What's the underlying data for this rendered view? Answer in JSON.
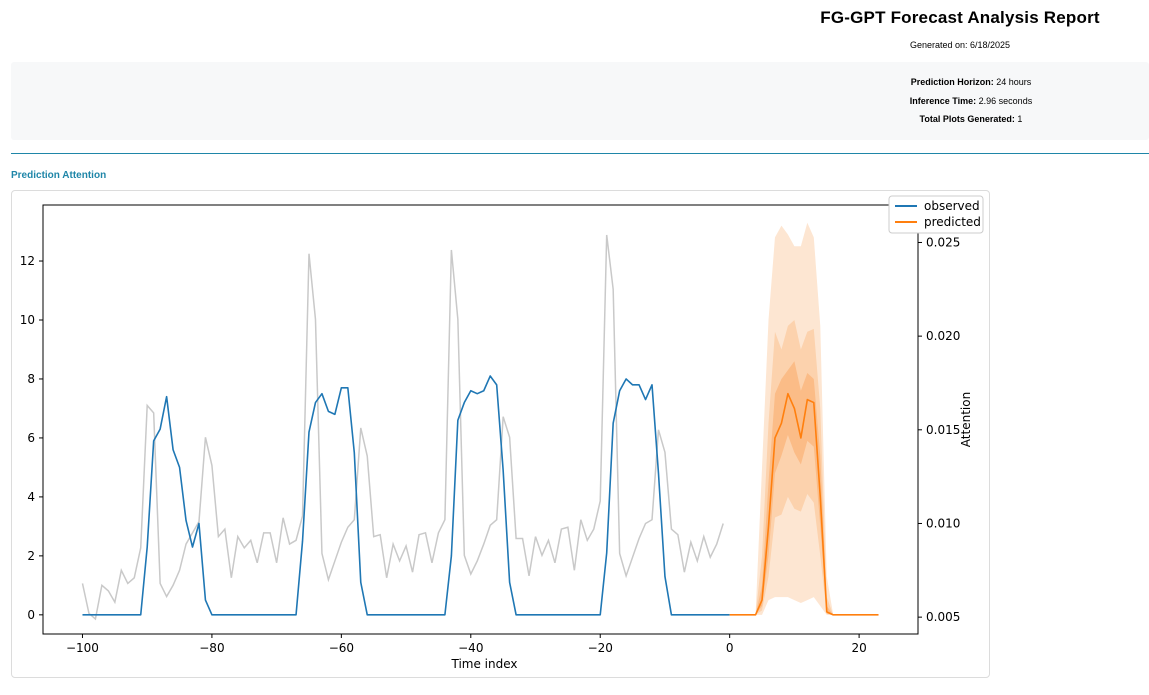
{
  "report": {
    "title": "FG-GPT Forecast Analysis Report",
    "generated_label": "Generated on:",
    "generated_date": "6/18/2025"
  },
  "summary": {
    "horizon_label": "Prediction Horizon:",
    "horizon_value": "24 hours",
    "inference_label": "Inference Time:",
    "inference_value": "2.96 seconds",
    "plots_label": "Total Plots Generated:",
    "plots_value": "1"
  },
  "section": {
    "title": "Prediction Attention"
  },
  "chart_data": {
    "type": "line",
    "xlabel": "Time index",
    "ylabel": "",
    "y2label": "Attention",
    "xlim": [
      -106.1,
      29.1
    ],
    "ylim": [
      -0.65,
      13.9
    ],
    "y2lim": [
      0.0041,
      0.027
    ],
    "xticks": [
      -100,
      -80,
      -60,
      -40,
      -20,
      0,
      20
    ],
    "xtick_labels": [
      "−100",
      "−80",
      "−60",
      "−40",
      "−20",
      "0",
      "20"
    ],
    "yticks": [
      0,
      2,
      4,
      6,
      8,
      10,
      12
    ],
    "y2ticks": [
      0.005,
      0.01,
      0.015,
      0.02,
      0.025
    ],
    "y2tick_labels": [
      "0.005",
      "0.010",
      "0.015",
      "0.020",
      "0.025"
    ],
    "legend_position": "top-right",
    "legend": [
      {
        "name": "observed",
        "color": "#1f77b4"
      },
      {
        "name": "predicted",
        "color": "#ff7f0e"
      }
    ],
    "colors": {
      "observed": "#1f77b4",
      "predicted": "#ff7f0e",
      "attention": "#c9c9c9",
      "band_outer": "#fde6d2",
      "band_middle": "#fcd2ad",
      "band_inner": "#fbbc87"
    },
    "observed": {
      "x_start": -100,
      "values": [
        0,
        0,
        0,
        0,
        0,
        0,
        0,
        0,
        0,
        0,
        2.3,
        5.9,
        6.3,
        7.4,
        5.6,
        5.0,
        3.2,
        2.3,
        3.1,
        0.5,
        0,
        0,
        0,
        0,
        0,
        0,
        0,
        0,
        0,
        0,
        0,
        0,
        0,
        0,
        2.5,
        6.2,
        7.2,
        7.5,
        6.9,
        6.8,
        7.7,
        7.7,
        5.5,
        1.1,
        0,
        0,
        0,
        0,
        0,
        0,
        0,
        0,
        0,
        0,
        0,
        0,
        0,
        2.0,
        6.6,
        7.2,
        7.6,
        7.5,
        7.6,
        8.1,
        7.8,
        4.9,
        1.1,
        0,
        0,
        0,
        0,
        0,
        0,
        0,
        0,
        0,
        0,
        0,
        0,
        0,
        0,
        2.1,
        6.5,
        7.6,
        8.0,
        7.8,
        7.8,
        7.3,
        7.8,
        4.8,
        1.3,
        0,
        0,
        0,
        0,
        0,
        0,
        0,
        0,
        0,
        0
      ]
    },
    "predicted": {
      "x_start": 0,
      "median": [
        0,
        0,
        0,
        0,
        0,
        0.5,
        3.0,
        6.0,
        6.5,
        7.5,
        7.0,
        6.0,
        7.3,
        7.2,
        4.0,
        0.1,
        0,
        0,
        0,
        0,
        0,
        0,
        0,
        0
      ],
      "band_inner_low": [
        0,
        0,
        0,
        0,
        0,
        0.3,
        2.0,
        4.8,
        5.4,
        6.1,
        5.5,
        5.1,
        5.9,
        5.7,
        3.0,
        0.05,
        0,
        0,
        0,
        0,
        0,
        0,
        0,
        0
      ],
      "band_inner_high": [
        0,
        0,
        0,
        0,
        0,
        1.0,
        4.5,
        7.5,
        8.0,
        8.3,
        8.6,
        7.6,
        8.2,
        8.0,
        5.4,
        0.3,
        0,
        0,
        0,
        0,
        0,
        0,
        0,
        0
      ],
      "band_middle_low": [
        0,
        0,
        0,
        0,
        0,
        0.15,
        1.3,
        3.3,
        3.4,
        4.0,
        3.6,
        3.5,
        4.1,
        3.8,
        2.0,
        0.03,
        0,
        0,
        0,
        0,
        0,
        0,
        0,
        0
      ],
      "band_middle_high": [
        0,
        0,
        0,
        0,
        0,
        2.0,
        6.5,
        9.6,
        9.0,
        9.8,
        10.0,
        9.0,
        9.6,
        9.7,
        7.0,
        0.6,
        0,
        0,
        0,
        0,
        0,
        0,
        0,
        0
      ],
      "band_outer_low": [
        0,
        0,
        0,
        0,
        0,
        0,
        0.5,
        0.6,
        0.6,
        0.6,
        0.5,
        0.4,
        0.5,
        0.6,
        0.3,
        0,
        0,
        0,
        0,
        0,
        0,
        0,
        0,
        0
      ],
      "band_outer_high": [
        0,
        0,
        0,
        0,
        0,
        5.0,
        10.0,
        12.8,
        13.2,
        12.9,
        12.5,
        12.5,
        13.3,
        12.8,
        9.8,
        1.3,
        0,
        0,
        0,
        0,
        0,
        0,
        0,
        0
      ]
    },
    "attention": {
      "x_start": -100,
      "values": [
        0.0068,
        0.0052,
        0.0049,
        0.0067,
        0.0064,
        0.0058,
        0.0075,
        0.0068,
        0.0071,
        0.0087,
        0.0163,
        0.0159,
        0.0068,
        0.0061,
        0.0067,
        0.0075,
        0.0089,
        0.0095,
        0.0101,
        0.0146,
        0.0131,
        0.0093,
        0.0097,
        0.0071,
        0.0093,
        0.0087,
        0.0091,
        0.0079,
        0.0095,
        0.0095,
        0.0079,
        0.0103,
        0.0089,
        0.0091,
        0.0104,
        0.0244,
        0.0209,
        0.0084,
        0.007,
        0.008,
        0.009,
        0.0098,
        0.0102,
        0.0151,
        0.0136,
        0.0093,
        0.0094,
        0.0071,
        0.0089,
        0.008,
        0.0088,
        0.0074,
        0.0094,
        0.0095,
        0.0079,
        0.0095,
        0.0102,
        0.0246,
        0.0209,
        0.0083,
        0.0073,
        0.008,
        0.0089,
        0.0099,
        0.0102,
        0.0157,
        0.0146,
        0.0092,
        0.0092,
        0.0072,
        0.0093,
        0.0083,
        0.0091,
        0.0079,
        0.0097,
        0.0098,
        0.0075,
        0.0102,
        0.0091,
        0.0097,
        0.0112,
        0.0254,
        0.0225,
        0.0084,
        0.0072,
        0.0082,
        0.0092,
        0.01,
        0.0102,
        0.015,
        0.0138,
        0.0097,
        0.0094,
        0.0074,
        0.009,
        0.008,
        0.0093,
        0.0082,
        0.0089,
        0.01
      ]
    }
  }
}
